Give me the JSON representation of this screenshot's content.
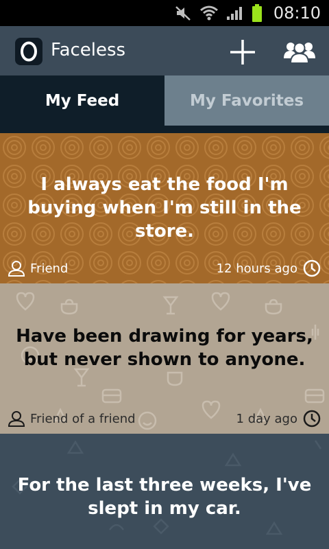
{
  "status_bar": {
    "time": "08:10"
  },
  "app": {
    "title": "Faceless"
  },
  "tabs": [
    {
      "label": "My Feed",
      "active": true
    },
    {
      "label": "My Favorites",
      "active": false
    }
  ],
  "posts": [
    {
      "text": "I always eat the food I'm buying when I'm still in the store.",
      "author": "Friend",
      "time": "12 hours ago",
      "bg_color": "#a3692a"
    },
    {
      "text": "Have been drawing for years, but never shown to anyone.",
      "author": "Friend of a friend",
      "time": "1 day ago",
      "bg_color": "#b2a593"
    },
    {
      "text": "For the last three weeks, I've slept in my car.",
      "bg_color": "#3d4d5b"
    }
  ],
  "icons": {
    "status": [
      "mute-icon",
      "wifi-icon",
      "signal-icon",
      "battery-icon"
    ],
    "actionbar": [
      "app-logo-icon",
      "add-icon",
      "friends-icon"
    ],
    "post_meta": [
      "person-icon",
      "clock-icon"
    ]
  }
}
